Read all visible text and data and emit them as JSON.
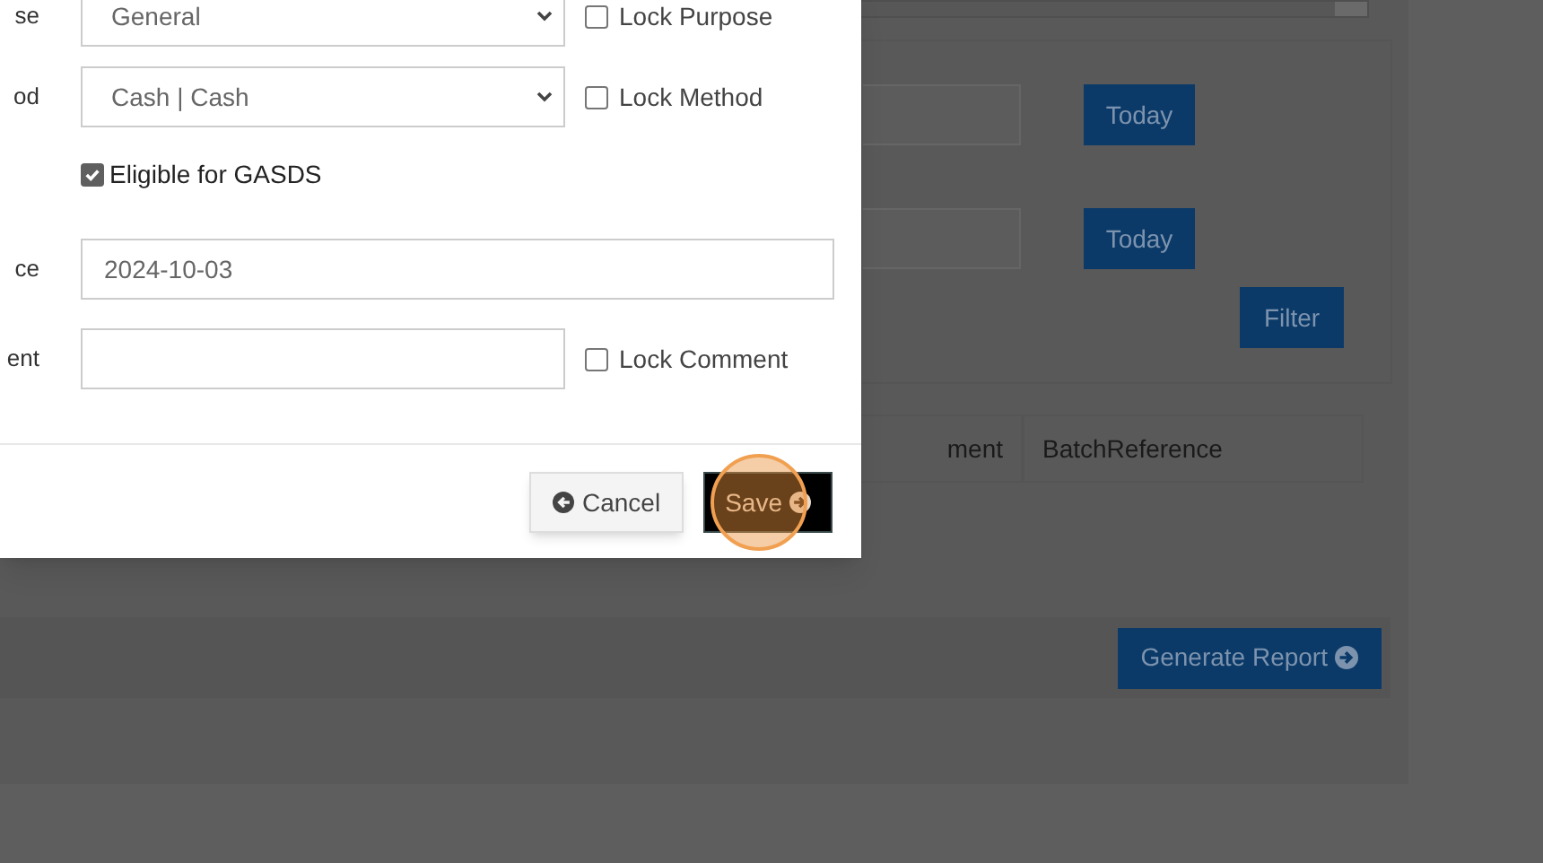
{
  "background": {
    "date_filters": [
      {
        "button": "Today"
      },
      {
        "button": "Today"
      }
    ],
    "filter_button": "Filter",
    "table": {
      "columns": [
        "ment",
        "BatchReference"
      ]
    },
    "generate_button": "Generate Report"
  },
  "dialog": {
    "rows": [
      {
        "kind": "select",
        "label": "se",
        "value": "General",
        "lock": {
          "label": "Lock Purpose",
          "checked": false
        }
      },
      {
        "kind": "select",
        "label": "od",
        "value": "Cash | Cash",
        "lock": {
          "label": "Lock Method",
          "checked": false
        }
      },
      {
        "kind": "checkbox",
        "label": "Eligible for GASDS",
        "checked": true
      },
      {
        "kind": "input",
        "label": "ce",
        "value": "2024-10-03",
        "wide": true
      },
      {
        "kind": "input",
        "label": "ent",
        "value": "",
        "lock": {
          "label": "Lock Comment",
          "checked": false
        }
      }
    ],
    "buttons": [
      {
        "kind": "cancel",
        "label": "Cancel"
      },
      {
        "kind": "save",
        "label": "Save",
        "highlighted": true
      }
    ]
  }
}
